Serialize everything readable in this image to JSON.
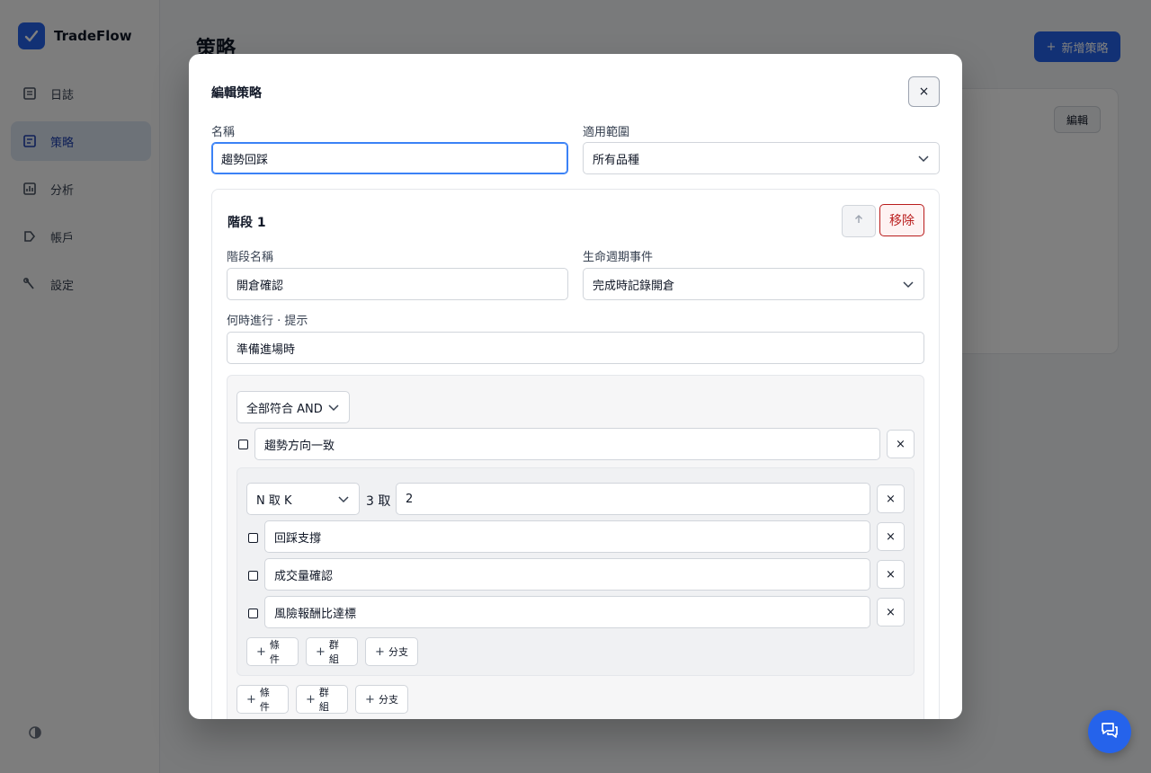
{
  "app": {
    "brand": "TradeFlow",
    "nav": [
      "日誌",
      "策略",
      "分析",
      "帳戶",
      "設定"
    ],
    "page_title": "策略",
    "new_button": "新增策略",
    "edit_button": "編輯"
  },
  "modal": {
    "title": "編輯策略",
    "close": "×",
    "name_label": "名稱",
    "name_value": "趨勢回踩",
    "scope_label": "適用範圍",
    "scope_value": "所有品種",
    "stage": {
      "title": "階段 1",
      "remove": "移除",
      "stage_name_label": "階段名稱",
      "stage_name_value": "開倉確認",
      "lifecycle_label": "生命週期事件",
      "lifecycle_value": "完成時記錄開倉",
      "hint_label": "何時進行 · 提示",
      "hint_value": "準備進場時",
      "root_group": {
        "mode": "全部符合 AND",
        "condition": "趨勢方向一致",
        "nested_group": {
          "mode": "N 取 K",
          "n_of_label": "3 取",
          "k_value": "2",
          "conditions": [
            "回踩支撐",
            "成交量確認",
            "風險報酬比達標"
          ]
        }
      },
      "add_buttons": {
        "condition": "條件",
        "group": "群組",
        "branch": "分支"
      },
      "remove_x": "×"
    }
  },
  "colors": {
    "accent": "#2563eb",
    "danger": "#b91c1c",
    "focus": "#3b82f6"
  }
}
